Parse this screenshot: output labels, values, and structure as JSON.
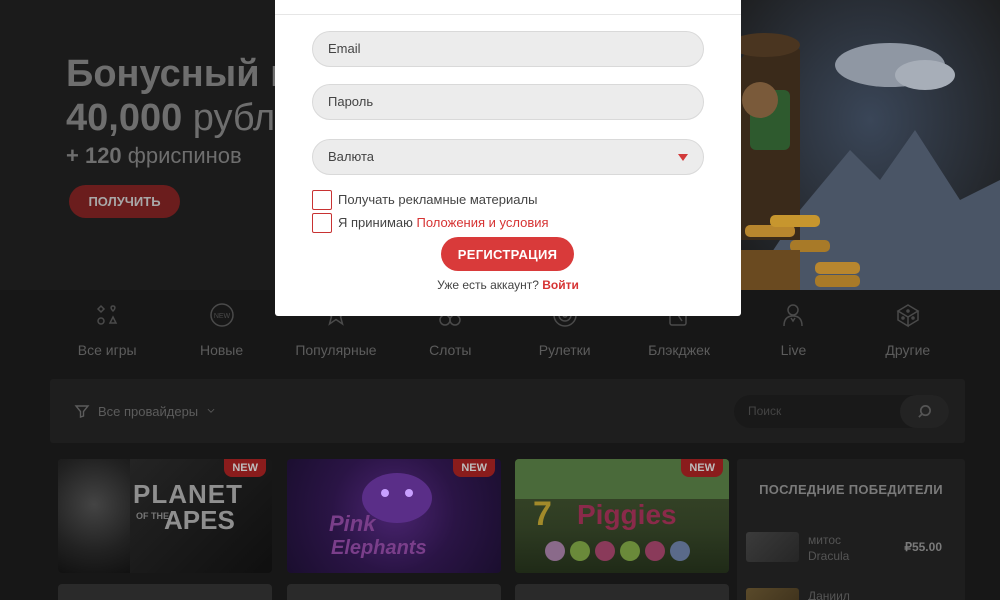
{
  "hero": {
    "title": "Бонусный пакет",
    "amount": "40,000",
    "currency": "рублей",
    "spins_prefix": "+ 120",
    "spins_text": "фриспинов",
    "cta": "ПОЛУЧИТЬ"
  },
  "categories": [
    {
      "label": "Все игры",
      "icon": "all-games-icon"
    },
    {
      "label": "Новые",
      "icon": "new-icon"
    },
    {
      "label": "Популярные",
      "icon": "star-icon"
    },
    {
      "label": "Слоты",
      "icon": "slots-icon"
    },
    {
      "label": "Рулетки",
      "icon": "roulette-icon"
    },
    {
      "label": "Блэкджек",
      "icon": "cards-icon"
    },
    {
      "label": "Live",
      "icon": "dealer-icon"
    },
    {
      "label": "Другие",
      "icon": "dice-icon"
    }
  ],
  "filter": {
    "providers": "Все провайдеры",
    "search_placeholder": "Поиск"
  },
  "games": [
    {
      "title_line1": "PLANET",
      "title_line2": "APES",
      "of_the": "OF THE",
      "badge": "NEW"
    },
    {
      "title_line1": "Pink",
      "title_line2": "Elephants",
      "badge": "NEW"
    },
    {
      "title_line1": "7",
      "title_line2": "Piggies",
      "badge": "NEW"
    }
  ],
  "winners": {
    "title": "ПОСЛЕДНИЕ ПОБЕДИТЕЛИ",
    "rows": [
      {
        "name": "митос",
        "game": "Dracula",
        "amount": "₽55.00"
      },
      {
        "name": "Даниил",
        "game": "",
        "amount": ""
      }
    ]
  },
  "modal": {
    "email_placeholder": "Email",
    "password_placeholder": "Пароль",
    "currency_placeholder": "Валюта",
    "promo_label": "Получать рекламные материалы",
    "accept_prefix": "Я принимаю",
    "terms_link": "Положения и условия",
    "register": "РЕГИСТРАЦИЯ",
    "have_account": "Уже есть аккаунт?",
    "login": "Войти"
  }
}
